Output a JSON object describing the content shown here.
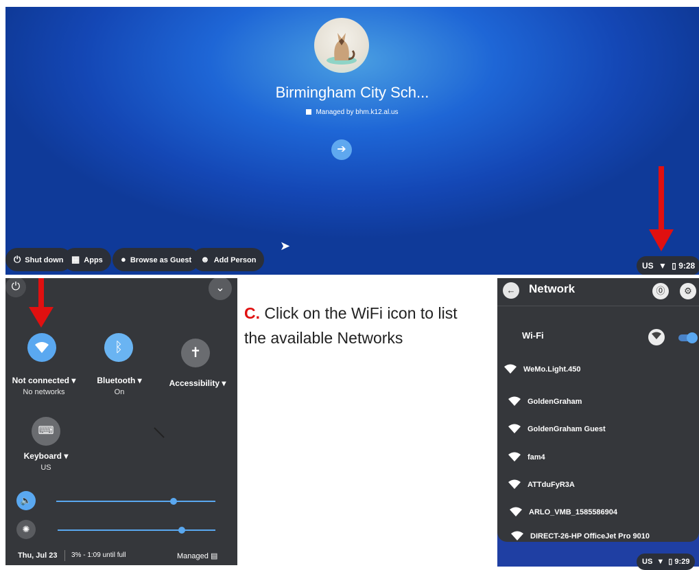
{
  "login": {
    "org_name": "Birmingham City Sch...",
    "managed_text": "Managed by bhm.k12.al.us",
    "shelf": {
      "shutdown": "Shut down",
      "apps": "Apps",
      "browse_guest": "Browse as Guest",
      "add_person": "Add Person"
    },
    "tray": {
      "lang": "US",
      "time": "9:28"
    }
  },
  "quick_settings": {
    "network": {
      "label": "Not connected ▾",
      "sub": "No networks"
    },
    "bluetooth": {
      "label": "Bluetooth ▾",
      "sub": "On"
    },
    "accessibility": {
      "label": "Accessibility ▾"
    },
    "keyboard": {
      "label": "Keyboard ▾",
      "sub": "US"
    },
    "volume_level": 0.74,
    "brightness_level": 0.79,
    "footer": {
      "date": "Thu, Jul 23",
      "battery": "3% - 1:09 until full",
      "managed": "Managed"
    }
  },
  "instruction": {
    "letter": "C.",
    "text": " Click on the WiFi icon to list the available Networks"
  },
  "network_panel": {
    "title": "Network",
    "wifi_label": "Wi-Fi",
    "wifi_enabled": true,
    "networks": [
      "WeMo.Light.450",
      "GoldenGraham",
      "GoldenGraham Guest",
      "fam4",
      "ATTduFyR3A",
      "ARLO_VMB_1585586904",
      "DIRECT-26-HP OfficeJet Pro 9010"
    ],
    "tray": {
      "lang": "US",
      "time": "9:29"
    }
  },
  "colors": {
    "accent_red": "#e01010",
    "chrome_blue": "#5aa8f0",
    "panel_bg": "#35373b"
  },
  "icons": [
    "power-icon",
    "apps-grid-icon",
    "guest-icon",
    "add-person-icon",
    "wifi-icon",
    "battery-icon",
    "bluetooth-icon",
    "accessibility-icon",
    "keyboard-icon",
    "volume-icon",
    "brightness-icon",
    "building-icon",
    "back-arrow-icon",
    "info-icon",
    "gear-icon",
    "chevron-down-icon"
  ]
}
